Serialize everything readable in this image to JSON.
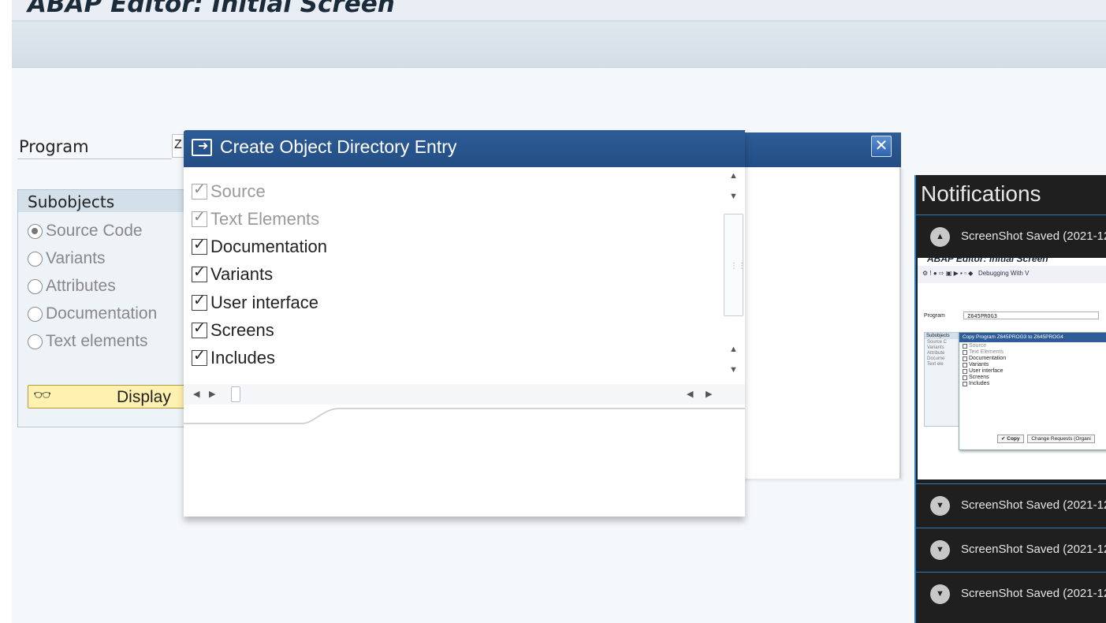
{
  "sap": {
    "title": "ABAP Editor: Initial Screen",
    "program_label": "Program",
    "program_value": "Z",
    "subobjects": {
      "header": "Subobjects",
      "options": [
        "Source Code",
        "Variants",
        "Attributes",
        "Documentation",
        "Text elements"
      ],
      "selected": "Source Code"
    },
    "display_button": "Display"
  },
  "dialog": {
    "title": "Create Object Directory Entry",
    "close_glyph": "✕",
    "items": [
      {
        "label": "Source",
        "checked": true,
        "enabled": false
      },
      {
        "label": "Text Elements",
        "checked": true,
        "enabled": false
      },
      {
        "label": "Documentation",
        "checked": true,
        "enabled": true
      },
      {
        "label": "Variants",
        "checked": true,
        "enabled": true
      },
      {
        "label": "User interface",
        "checked": true,
        "enabled": true
      },
      {
        "label": "Screens",
        "checked": true,
        "enabled": true
      },
      {
        "label": "Includes",
        "checked": true,
        "enabled": true
      }
    ],
    "accent_color": "#2a5991"
  },
  "notifications": {
    "title": "Notifications",
    "items": [
      {
        "text": "ScreenShot Saved  (2021-12",
        "expanded": true
      },
      {
        "text": "ScreenShot Saved  (2021-12",
        "expanded": false
      },
      {
        "text": "ScreenShot Saved  (2021-12",
        "expanded": false
      },
      {
        "text": "ScreenShot Saved  (2021-12",
        "expanded": false
      }
    ],
    "thumbnail": {
      "title": "ABAP Editor: Initial Screen",
      "toolbar": "Debugging  With V",
      "program_label": "Program",
      "program_value": "Z645PROG3",
      "subobjects_header": "Subobjects",
      "subobjects": [
        "Source C",
        "Variants",
        "Attribute",
        "Docume",
        "Text ele"
      ],
      "dialog_title": "Copy Program Z645PROG3 to Z645PROG4",
      "items": [
        {
          "label": "Source",
          "checked": true,
          "enabled": false
        },
        {
          "label": "Text Elements",
          "checked": true,
          "enabled": false
        },
        {
          "label": "Documentation",
          "checked": false,
          "enabled": true
        },
        {
          "label": "Variants",
          "checked": false,
          "enabled": true
        },
        {
          "label": "User interface",
          "checked": false,
          "enabled": true
        },
        {
          "label": "Screens",
          "checked": false,
          "enabled": true
        },
        {
          "label": "Includes",
          "checked": false,
          "enabled": true
        }
      ],
      "buttons": [
        "Copy",
        "Change Requests (Organi"
      ]
    }
  }
}
